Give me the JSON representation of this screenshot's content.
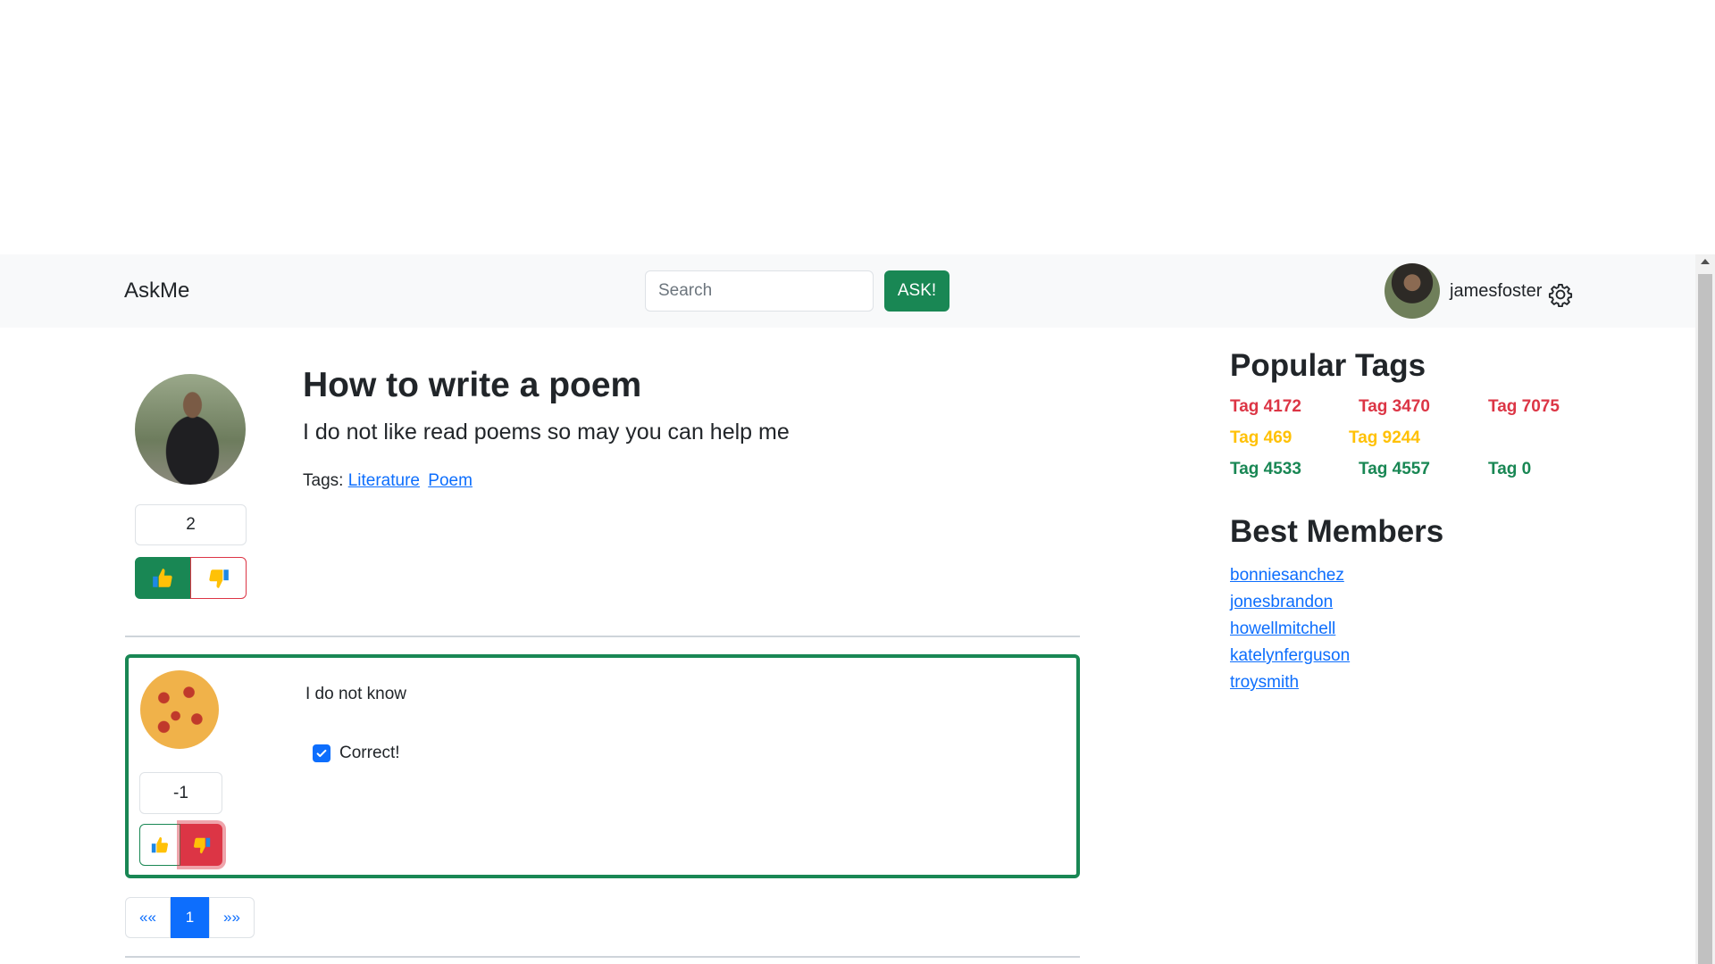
{
  "navbar": {
    "brand": "AskMe",
    "search_placeholder": "Search",
    "ask_label": "ASK!",
    "username": "jamesfoster"
  },
  "question": {
    "title": "How to write a poem",
    "body": "I do not like read poems so may you can help me",
    "tags_label": "Tags:",
    "tags": [
      "Literature",
      "Poem"
    ],
    "score": "2"
  },
  "answer": {
    "body": "I do not know",
    "correct_label": "Correct!",
    "correct_checked": true,
    "score": "-1"
  },
  "pagination": {
    "prev": "««",
    "current": "1",
    "next": "»»"
  },
  "sidebar": {
    "popular_tags_title": "Popular Tags",
    "tags": [
      {
        "label": "Tag 4172",
        "color": "#dc3545"
      },
      {
        "label": "Tag 3470",
        "color": "#dc3545"
      },
      {
        "label": "Tag 7075",
        "color": "#dc3545"
      },
      {
        "label": "Tag 469",
        "color": "#ffc107"
      },
      {
        "label": "Tag 9244",
        "color": "#ffc107"
      },
      {
        "label": "Tag 4533",
        "color": "#198754"
      },
      {
        "label": "Tag 4557",
        "color": "#198754"
      },
      {
        "label": "Tag 0",
        "color": "#198754"
      }
    ],
    "best_members_title": "Best Members",
    "members": [
      "bonniesanchez",
      "jonesbrandon",
      "howellmitchell",
      "katelynferguson",
      "troysmith"
    ]
  },
  "colors": {
    "success": "#198754",
    "danger": "#dc3545",
    "warning": "#ffc107",
    "primary": "#0d6efd",
    "navbar_bg": "#f8f9fa"
  },
  "icons": {
    "upvote": "thumbs-up-icon",
    "downvote": "thumbs-down-icon",
    "settings": "gear-icon"
  }
}
